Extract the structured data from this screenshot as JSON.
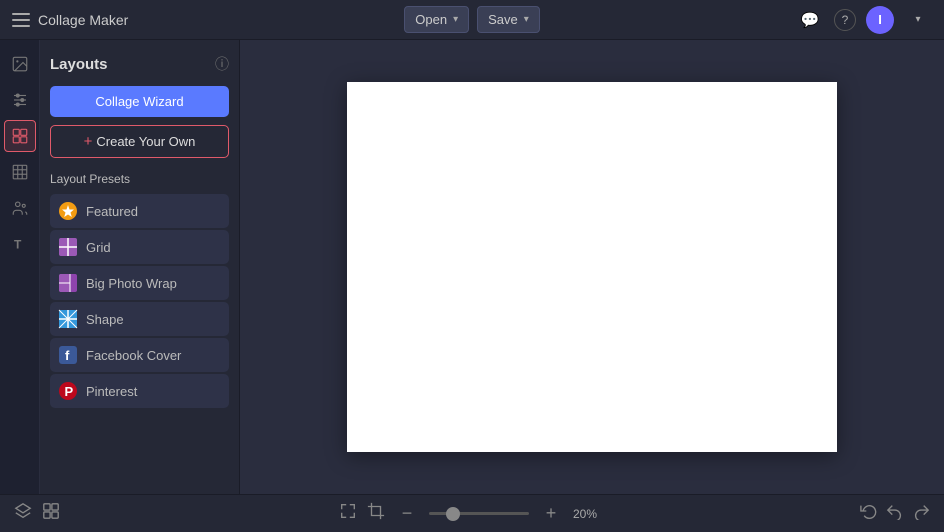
{
  "app": {
    "title": "Collage Maker"
  },
  "topbar": {
    "open_label": "Open",
    "save_label": "Save",
    "avatar_letter": "I"
  },
  "panel": {
    "title": "Layouts",
    "collage_wizard_label": "Collage Wizard",
    "create_your_own_label": "Create Your Own",
    "presets_title": "Layout Presets",
    "presets": [
      {
        "id": "featured",
        "label": "Featured",
        "icon": "⭐"
      },
      {
        "id": "grid",
        "label": "Grid",
        "icon": "⊞"
      },
      {
        "id": "big-photo-wrap",
        "label": "Big Photo Wrap",
        "icon": "▦"
      },
      {
        "id": "shape",
        "label": "Shape",
        "icon": "✦"
      },
      {
        "id": "facebook-cover",
        "label": "Facebook Cover",
        "icon": "f"
      },
      {
        "id": "pinterest",
        "label": "Pinterest",
        "icon": "P"
      }
    ]
  },
  "bottombar": {
    "zoom_percent": "20%",
    "zoom_value": "20"
  },
  "icons": {
    "hamburger": "≡",
    "chat": "💬",
    "help": "?",
    "layers": "⊛",
    "grid_bottom": "⊞",
    "expand": "⛶",
    "crop": "⊡",
    "minus": "−",
    "plus_zoom": "+",
    "undo_alt": "↺",
    "undo": "↩",
    "redo": "↪"
  }
}
